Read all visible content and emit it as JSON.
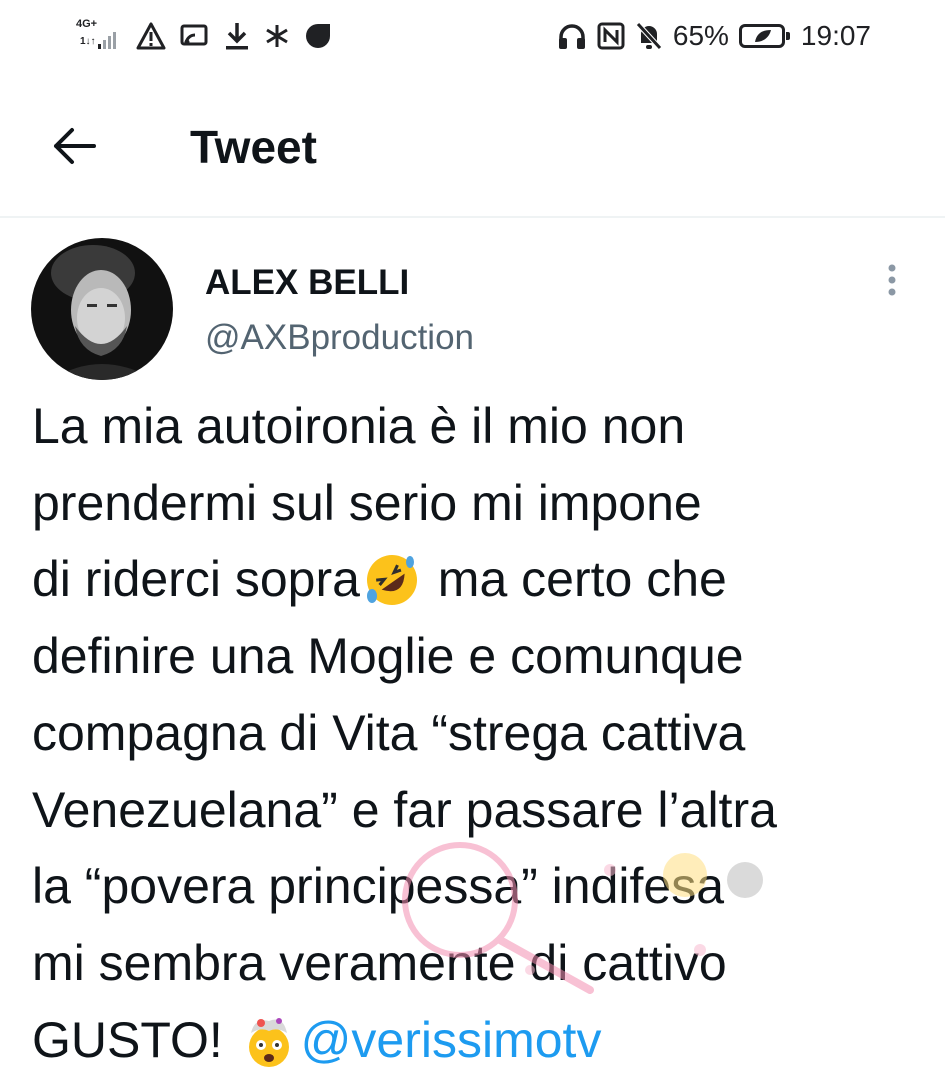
{
  "status_bar": {
    "network": "4G+",
    "network_sub": "1↓↑",
    "left_icons": [
      "signal-icon",
      "warning-icon",
      "cast-icon",
      "download-icon",
      "asterisk-icon",
      "record-icon"
    ],
    "right_icons": [
      "headphones-icon",
      "nfc-icon",
      "mute-bell-icon",
      "battery-icon"
    ],
    "battery": "65%",
    "time": "19:07"
  },
  "header": {
    "back_icon": "arrow-left-icon",
    "title": "Tweet"
  },
  "tweet": {
    "author_name": "ALEX BELLI",
    "author_handle": "@AXBproduction",
    "more_icon": "vertical-dots-icon",
    "lines": [
      "La mia autoironia è il mio non",
      "prendermi sul serio mi impone",
      "di riderci sopra",
      " ma certo che",
      "definire una Moglie e comunque",
      "compagna di Vita “strega cattiva",
      "Venezuelana” e far passare l’altra",
      "la “povera principessa” indifesa",
      "mi sembra veramente di cattivo",
      "GUSTO! "
    ],
    "emoji_1": "rolling-on-floor-laughing-emoji",
    "emoji_2": "exploding-head-emoji",
    "mention": "@verissimotv"
  },
  "colors": {
    "text": "#0f1419",
    "secondary": "#536471",
    "link": "#1d9bf0",
    "divider": "#eff3f4"
  }
}
